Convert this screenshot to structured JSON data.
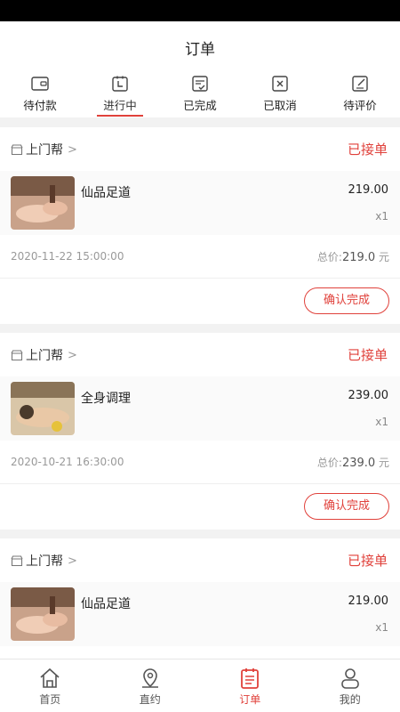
{
  "header": {
    "title": "订单"
  },
  "tabs": [
    {
      "label": "待付款",
      "icon": "wallet-icon"
    },
    {
      "label": "进行中",
      "icon": "clock-icon",
      "active": true
    },
    {
      "label": "已完成",
      "icon": "check-doc-icon"
    },
    {
      "label": "已取消",
      "icon": "cancel-icon"
    },
    {
      "label": "待评价",
      "icon": "edit-icon"
    }
  ],
  "orders": [
    {
      "store": "上门帮",
      "status": "已接单",
      "item_name": "仙品足道",
      "price": "219.00",
      "qty": "x1",
      "date": "2020-11-22 15:00:00",
      "total_label": "总价:",
      "total": "219.0",
      "currency": "元",
      "action": "确认完成",
      "thumb": "foot-spa"
    },
    {
      "store": "上门帮",
      "status": "已接单",
      "item_name": "全身调理",
      "price": "239.00",
      "qty": "x1",
      "date": "2020-10-21 16:30:00",
      "total_label": "总价:",
      "total": "239.0",
      "currency": "元",
      "action": "确认完成",
      "thumb": "body-massage"
    },
    {
      "store": "上门帮",
      "status": "已接单",
      "item_name": "仙品足道",
      "price": "219.00",
      "qty": "x1",
      "thumb": "foot-spa"
    }
  ],
  "nav": [
    {
      "label": "首页",
      "icon": "home-icon"
    },
    {
      "label": "直约",
      "icon": "location-icon"
    },
    {
      "label": "订单",
      "icon": "orders-icon",
      "active": true
    },
    {
      "label": "我的",
      "icon": "user-icon"
    }
  ],
  "colors": {
    "accent": "#e0413b",
    "background": "#f2f2f2"
  }
}
